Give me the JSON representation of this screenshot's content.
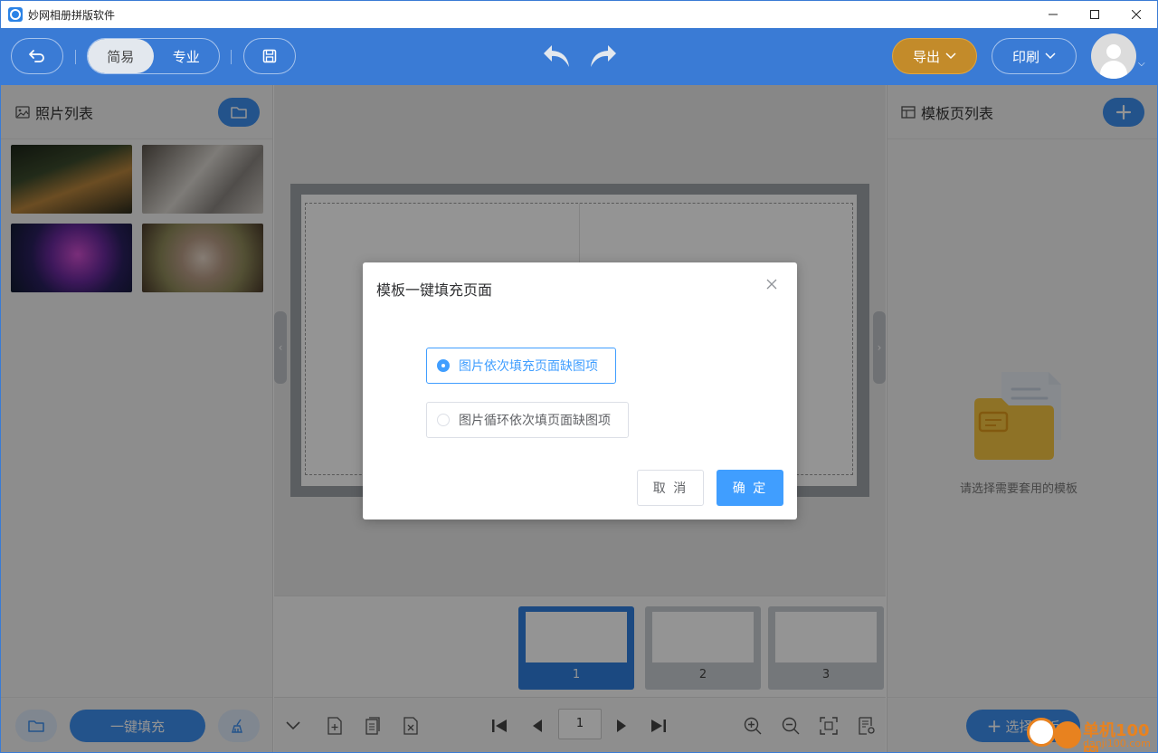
{
  "window": {
    "title": "妙网相册拼版软件",
    "controls": [
      "minimize-icon",
      "maximize-icon",
      "close-icon"
    ]
  },
  "toolbar": {
    "mode_simple": "简易",
    "mode_pro": "专业",
    "active_mode": "简易",
    "export_label": "导出",
    "print_label": "印刷",
    "accent": "#3a7bd5",
    "export_color": "#c38b2a"
  },
  "left_panel": {
    "title": "照片列表",
    "photos": [
      {
        "name": "photo-1",
        "colors": [
          "#3b4a2c",
          "#b9853d",
          "#1c2418"
        ]
      },
      {
        "name": "photo-2",
        "colors": [
          "#8a8580",
          "#d9d5cf",
          "#5a534b"
        ]
      },
      {
        "name": "photo-3",
        "colors": [
          "#2a1f5e",
          "#d14fd1",
          "#1b8fb5"
        ]
      },
      {
        "name": "photo-4",
        "colors": [
          "#8f8a5a",
          "#e6d6c8",
          "#6e4a3a"
        ]
      }
    ],
    "fill_button": "一键填充"
  },
  "pages": {
    "items": [
      "1",
      "2",
      "3"
    ],
    "selected": "1",
    "current_page": "1"
  },
  "right_panel": {
    "title": "模板页列表",
    "empty_text": "请选择需要套用的模板",
    "select_button": "选择模板"
  },
  "dialog": {
    "title": "模板一键填充页面",
    "options": [
      {
        "label": "图片依次填充页面缺图项",
        "selected": true
      },
      {
        "label": "图片循环依次填页面缺图项",
        "selected": false
      }
    ],
    "cancel": "取 消",
    "confirm": "确 定",
    "primary_color": "#409eff"
  },
  "watermark": {
    "text": "单机100网",
    "sub": "danji100.com"
  }
}
